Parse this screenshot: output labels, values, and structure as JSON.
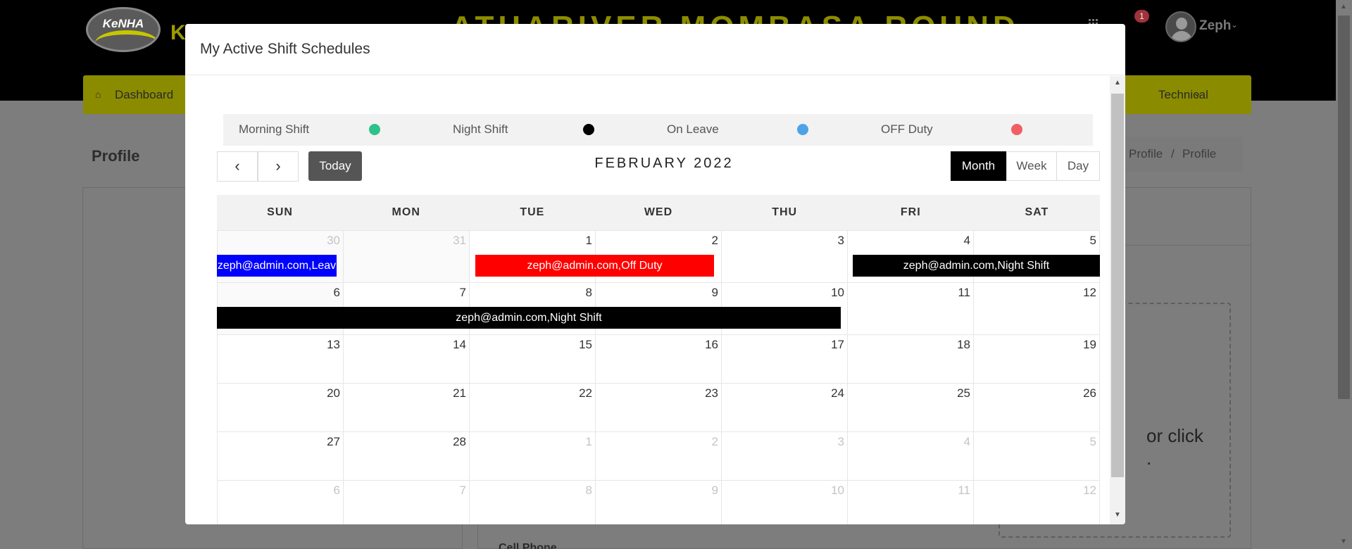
{
  "header": {
    "logo_text": "KeNHA",
    "logo_letter": "K",
    "site_title": "ATHARIVER MOMBASA ROUND",
    "notification_count": "1",
    "user_name": "Zeph"
  },
  "navbar": {
    "dashboard_label": "Dashboard",
    "technical_label": "Technical"
  },
  "page": {
    "title": "Profile",
    "breadcrumb": [
      "Profile",
      "Profile"
    ],
    "dropzone_text_line1": "or click",
    "dropzone_text_line2": ".",
    "cell_phone_label": "Cell Phone"
  },
  "modal": {
    "title": "My Active Shift Schedules",
    "close_label": "×",
    "legend": [
      {
        "label": "Morning Shift",
        "color": "#2ec28b"
      },
      {
        "label": "Night Shift",
        "color": "#000000"
      },
      {
        "label": "On Leave",
        "color": "#4ea3e8"
      },
      {
        "label": "OFF Duty",
        "color": "#ef5f63"
      }
    ],
    "calendar": {
      "prev_label": "‹",
      "next_label": "›",
      "today_label": "Today",
      "title": "FEBRUARY 2022",
      "views": [
        "Month",
        "Week",
        "Day"
      ],
      "active_view": "Month",
      "weekdays": [
        "SUN",
        "MON",
        "TUE",
        "WED",
        "THU",
        "FRI",
        "SAT"
      ],
      "weeks": [
        [
          {
            "d": "30",
            "other": true
          },
          {
            "d": "31",
            "other": true
          },
          {
            "d": "1"
          },
          {
            "d": "2"
          },
          {
            "d": "3"
          },
          {
            "d": "4"
          },
          {
            "d": "5"
          }
        ],
        [
          {
            "d": "6"
          },
          {
            "d": "7"
          },
          {
            "d": "8"
          },
          {
            "d": "9"
          },
          {
            "d": "10"
          },
          {
            "d": "11"
          },
          {
            "d": "12"
          }
        ],
        [
          {
            "d": "13"
          },
          {
            "d": "14"
          },
          {
            "d": "15"
          },
          {
            "d": "16"
          },
          {
            "d": "17"
          },
          {
            "d": "18"
          },
          {
            "d": "19"
          }
        ],
        [
          {
            "d": "20"
          },
          {
            "d": "21"
          },
          {
            "d": "22"
          },
          {
            "d": "23"
          },
          {
            "d": "24"
          },
          {
            "d": "25"
          },
          {
            "d": "26"
          }
        ],
        [
          {
            "d": "27"
          },
          {
            "d": "28"
          },
          {
            "d": "1",
            "other": true
          },
          {
            "d": "2",
            "other": true
          },
          {
            "d": "3",
            "other": true
          },
          {
            "d": "4",
            "other": true
          },
          {
            "d": "5",
            "other": true
          }
        ],
        [
          {
            "d": "6",
            "other": true
          },
          {
            "d": "7",
            "other": true
          },
          {
            "d": "8",
            "other": true
          },
          {
            "d": "9",
            "other": true
          },
          {
            "d": "10",
            "other": true
          },
          {
            "d": "11",
            "other": true
          },
          {
            "d": "12",
            "other": true
          }
        ]
      ],
      "events": [
        {
          "text": "zeph@admin.com,Leav",
          "color": "#0000ff"
        },
        {
          "text": "zeph@admin.com,Off Duty",
          "color": "#ff0000"
        },
        {
          "text": "zeph@admin.com,Night Shift",
          "color": "#000000"
        },
        {
          "text": "zeph@admin.com,Night Shift",
          "color": "#000000"
        }
      ]
    }
  }
}
